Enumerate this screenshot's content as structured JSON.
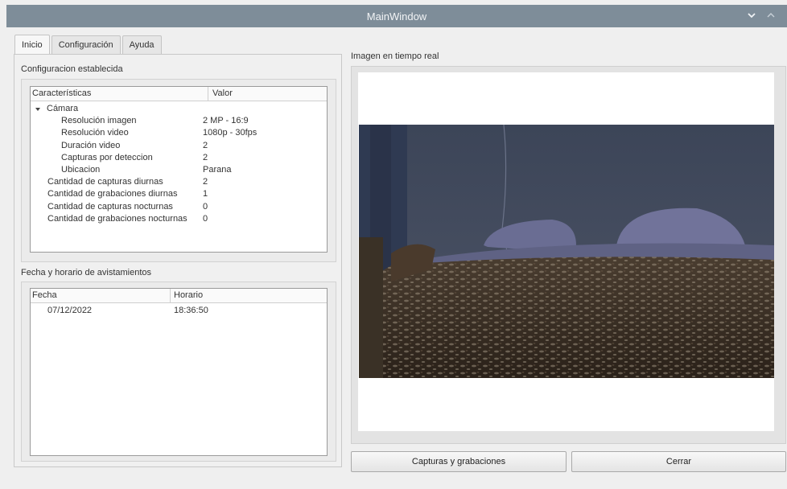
{
  "window": {
    "title": "MainWindow",
    "controls": [
      "minimize-icon",
      "maximize-icon"
    ]
  },
  "tabs": [
    {
      "label": "Inicio",
      "active": true
    },
    {
      "label": "Configuración",
      "active": false
    },
    {
      "label": "Ayuda",
      "active": false
    }
  ],
  "config": {
    "group_title": "Configuracion establecida",
    "columns": [
      "Características",
      "Valor"
    ],
    "camera": {
      "label": "Cámara",
      "children": [
        {
          "name": "Resolución imagen",
          "value": "2 MP - 16:9"
        },
        {
          "name": "Resolución video",
          "value": "1080p - 30fps"
        },
        {
          "name": "Duración video",
          "value": "2"
        },
        {
          "name": "Capturas por deteccion",
          "value": "2"
        },
        {
          "name": "Ubicacion",
          "value": "Parana"
        }
      ]
    },
    "items": [
      {
        "name": "Cantidad de capturas diurnas",
        "value": "2"
      },
      {
        "name": "Cantidad de grabaciones diurnas",
        "value": "1"
      },
      {
        "name": "Cantidad de capturas nocturnas",
        "value": "0"
      },
      {
        "name": "Cantidad de grabaciones nocturnas",
        "value": "0"
      }
    ]
  },
  "sightings": {
    "group_title": "Fecha y horario de avistamientos",
    "columns": [
      "Fecha",
      "Horario"
    ],
    "rows": [
      {
        "date": "07/12/2022",
        "time": "18:36:50"
      }
    ]
  },
  "video": {
    "label": "Imagen en tiempo real"
  },
  "buttons": {
    "captures": "Capturas y grabaciones",
    "close": "Cerrar"
  },
  "colors": {
    "titlebar": "#7e8d99",
    "window_bg": "#efefef"
  }
}
